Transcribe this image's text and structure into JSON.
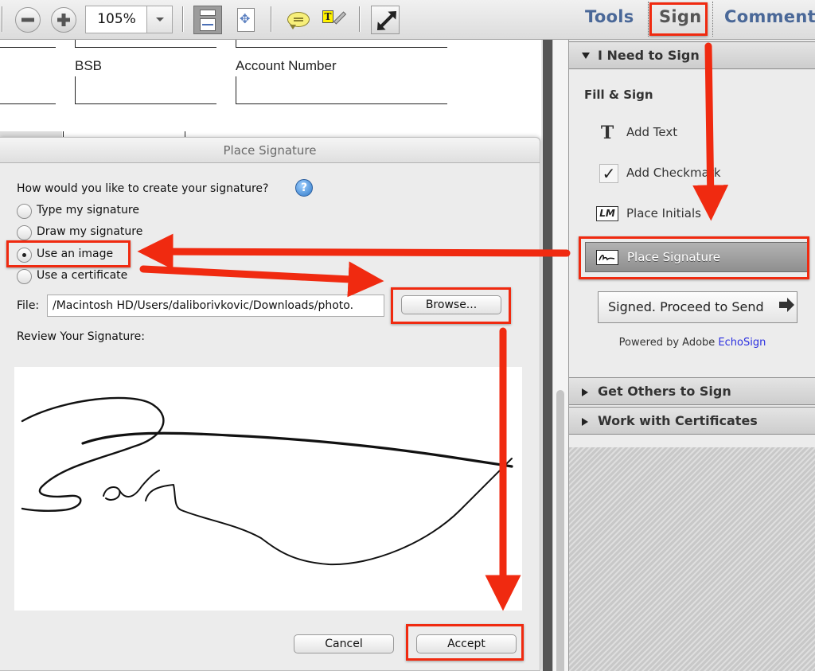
{
  "toolbar": {
    "zoom_value": "105%",
    "icons": [
      "zoom-out-icon",
      "zoom-in-icon",
      "fit-width-icon",
      "fit-page-icon",
      "comment-bubble-icon",
      "highlight-text-icon",
      "full-screen-icon"
    ],
    "tabs": [
      {
        "label": "Tools",
        "active": false
      },
      {
        "label": "Sign",
        "active": true
      },
      {
        "label": "Comment",
        "active": false
      }
    ]
  },
  "document": {
    "fields": [
      {
        "label": "BSB"
      },
      {
        "label": "Account Number"
      }
    ]
  },
  "dialog": {
    "title": "Place Signature",
    "question": "How would you like to create your signature?",
    "options": [
      {
        "label": "Type my signature",
        "selected": false
      },
      {
        "label": "Draw my signature",
        "selected": false
      },
      {
        "label": "Use an image",
        "selected": true
      },
      {
        "label": "Use a certificate",
        "selected": false
      }
    ],
    "file_label": "File:",
    "file_value": "/Macintosh HD/Users/daliborivkovic/Downloads/photo.",
    "browse_label": "Browse...",
    "review_label": "Review Your Signature:",
    "cancel_label": "Cancel",
    "accept_label": "Accept"
  },
  "panel": {
    "section_i_need_to_sign": "I Need to Sign",
    "fill_sign_heading": "Fill & Sign",
    "tools": [
      {
        "label": "Add Text",
        "icon": "text-icon"
      },
      {
        "label": "Add Checkmark",
        "icon": "checkmark-icon"
      },
      {
        "label": "Place Initials",
        "icon": "initials-icon",
        "icon_text": "LM"
      },
      {
        "label": "Place Signature",
        "icon": "signature-icon",
        "active": true
      }
    ],
    "proceed_label": "Signed. Proceed to Send",
    "powered_prefix": "Powered by Adobe ",
    "powered_brand": "EchoSign",
    "section_get_others": "Get Others to Sign",
    "section_certificates": "Work with Certificates"
  },
  "colors": {
    "annotation_red": "#f02a10",
    "tab_blue": "#4a6898",
    "echosign_blue": "#2a2ee0"
  }
}
